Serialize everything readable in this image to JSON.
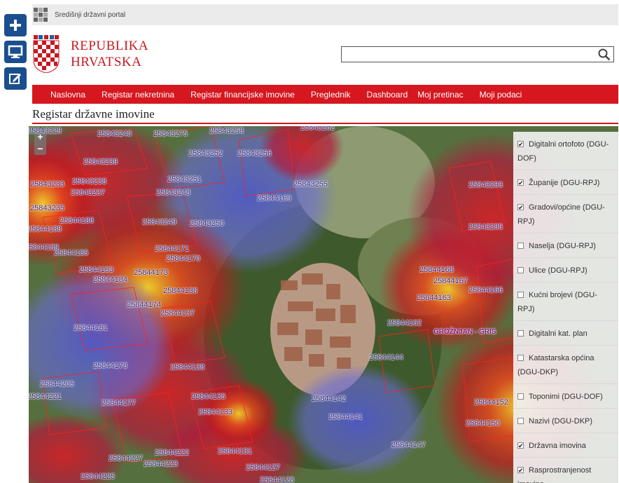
{
  "portal": {
    "label": "Središnji državni portal"
  },
  "brand": {
    "line1": "REPUBLIKA",
    "line2": "HRVATSKA"
  },
  "search": {
    "placeholder": "",
    "value": ""
  },
  "nav": [
    "Naslovna",
    "Registar nekretnina",
    "Registar financijske imovine",
    "Preglednik",
    "Dashboard",
    "Moj pretinac",
    "Moji podaci"
  ],
  "page": {
    "title": "Registar državne imovine"
  },
  "map": {
    "zoom_in": "+",
    "zoom_out": "−",
    "place_label": "GROŽNJAN - GRIS",
    "parcels": [
      {
        "t": "25843229"
      },
      {
        "t": "25843240"
      },
      {
        "t": "25843275"
      },
      {
        "t": "25843258"
      },
      {
        "t": "25843262"
      },
      {
        "t": "25843239"
      },
      {
        "t": "25843252"
      },
      {
        "t": "25843256"
      },
      {
        "t": "25843238"
      },
      {
        "t": "25843251"
      },
      {
        "t": "25843233"
      },
      {
        "t": "25843237"
      },
      {
        "t": "25843248"
      },
      {
        "t": "25843255"
      },
      {
        "t": "25843235"
      },
      {
        "t": "25844169"
      },
      {
        "t": "25844186"
      },
      {
        "t": "25843249"
      },
      {
        "t": "25843250"
      },
      {
        "t": "25844188"
      },
      {
        "t": "25844171"
      },
      {
        "t": "25844185"
      },
      {
        "t": "25844170"
      },
      {
        "t": "25844183"
      },
      {
        "t": "25844173"
      },
      {
        "t": "25844184"
      },
      {
        "t": "25844136"
      },
      {
        "t": "25844174"
      },
      {
        "t": "25844137"
      },
      {
        "t": "25844181"
      },
      {
        "t": "25844178"
      },
      {
        "t": "25844138"
      },
      {
        "t": "25844205"
      },
      {
        "t": "25844135"
      },
      {
        "t": "25844177"
      },
      {
        "t": "25844133"
      },
      {
        "t": "25844221"
      },
      {
        "t": "25844168"
      },
      {
        "t": "25844167"
      },
      {
        "t": "25844166"
      },
      {
        "t": "25844163"
      },
      {
        "t": "25844162"
      },
      {
        "t": "25844144"
      },
      {
        "t": "25844142"
      },
      {
        "t": "25844141"
      },
      {
        "t": "25844147"
      },
      {
        "t": "25844222"
      },
      {
        "t": "25844131"
      },
      {
        "t": "25844227"
      },
      {
        "t": "25844223"
      },
      {
        "t": "25844127"
      },
      {
        "t": "25844225"
      },
      {
        "t": "25844128"
      },
      {
        "t": "25843293"
      },
      {
        "t": "25843295"
      },
      {
        "t": "25844152"
      },
      {
        "t": "25844150"
      },
      {
        "t": "25844189"
      }
    ]
  },
  "layers": [
    {
      "label": "Digitalni ortofoto (DGU-DOF)",
      "checked": true
    },
    {
      "label": "Županije (DGU-RPJ)",
      "checked": true
    },
    {
      "label": "Gradovi/općine (DGU-RPJ)",
      "checked": true
    },
    {
      "label": "Naselja (DGU-RPJ)",
      "checked": false
    },
    {
      "label": "Ulice (DGU-RPJ)",
      "checked": false
    },
    {
      "label": "Kućni brojevi (DGU-RPJ)",
      "checked": false
    },
    {
      "label": "Digitalni kat. plan",
      "checked": false
    },
    {
      "label": "Katastarska općina (DGU-DKP)",
      "checked": false
    },
    {
      "label": "Toponimi (DGU-DOF)",
      "checked": false
    },
    {
      "label": "Nazivi (DGU-DKP)",
      "checked": false
    },
    {
      "label": "Državna imovina",
      "checked": true
    },
    {
      "label": "Rasprostranjenost imovine",
      "checked": true
    }
  ],
  "colors": {
    "brand_red": "#d6171f",
    "tool_blue": "#1a4e8f"
  },
  "icons": {
    "tool1": "plus-icon",
    "tool2": "monitor-icon",
    "tool3": "edit-icon",
    "search": "search-icon"
  }
}
